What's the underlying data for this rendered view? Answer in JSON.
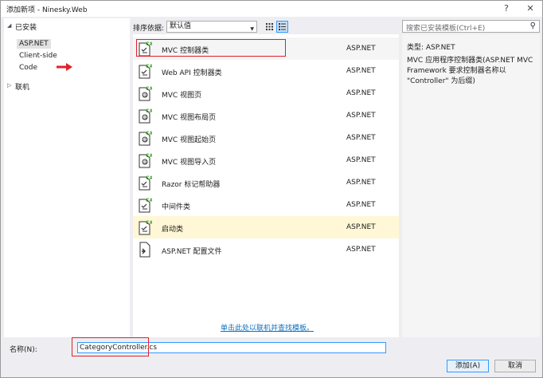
{
  "window": {
    "title": "添加新项 - Ninesky.Web",
    "help": "?",
    "close": "✕"
  },
  "tree": {
    "installed": "已安装",
    "children": [
      "ASP.NET",
      "Client-side",
      "Code"
    ],
    "online": "联机"
  },
  "toolbar": {
    "sort_label": "排序依据:",
    "sort_value": "默认值"
  },
  "search": {
    "placeholder": "搜索已安装模板(Ctrl+E)"
  },
  "items": [
    {
      "name": "MVC 控制器类",
      "lang": "ASP.NET"
    },
    {
      "name": "Web API 控制器类",
      "lang": "ASP.NET"
    },
    {
      "name": "MVC 视图页",
      "lang": "ASP.NET"
    },
    {
      "name": "MVC 视图布局页",
      "lang": "ASP.NET"
    },
    {
      "name": "MVC 视图起始页",
      "lang": "ASP.NET"
    },
    {
      "name": "MVC 视图导入页",
      "lang": "ASP.NET"
    },
    {
      "name": "Razor 标记帮助器",
      "lang": "ASP.NET"
    },
    {
      "name": "中间件类",
      "lang": "ASP.NET"
    },
    {
      "name": "启动类",
      "lang": "ASP.NET"
    },
    {
      "name": "ASP.NET 配置文件",
      "lang": "ASP.NET"
    }
  ],
  "online_link": "单击此处以联机并查找模板。",
  "details": {
    "type_line": "类型:  ASP.NET",
    "description": "MVC 应用程序控制器类(ASP.NET MVC Framework 要求控制器名称以 \"Controller\" 为后缀)"
  },
  "bottom": {
    "name_label": "名称(N):",
    "name_value": "CategoryController.cs",
    "add_button": "添加(A)",
    "cancel_button": "取消"
  },
  "colors": {
    "accent": "#3399ff",
    "annotation_red": "#e0202a",
    "selected_row": "#fff7d6",
    "link": "#0e70c0"
  }
}
